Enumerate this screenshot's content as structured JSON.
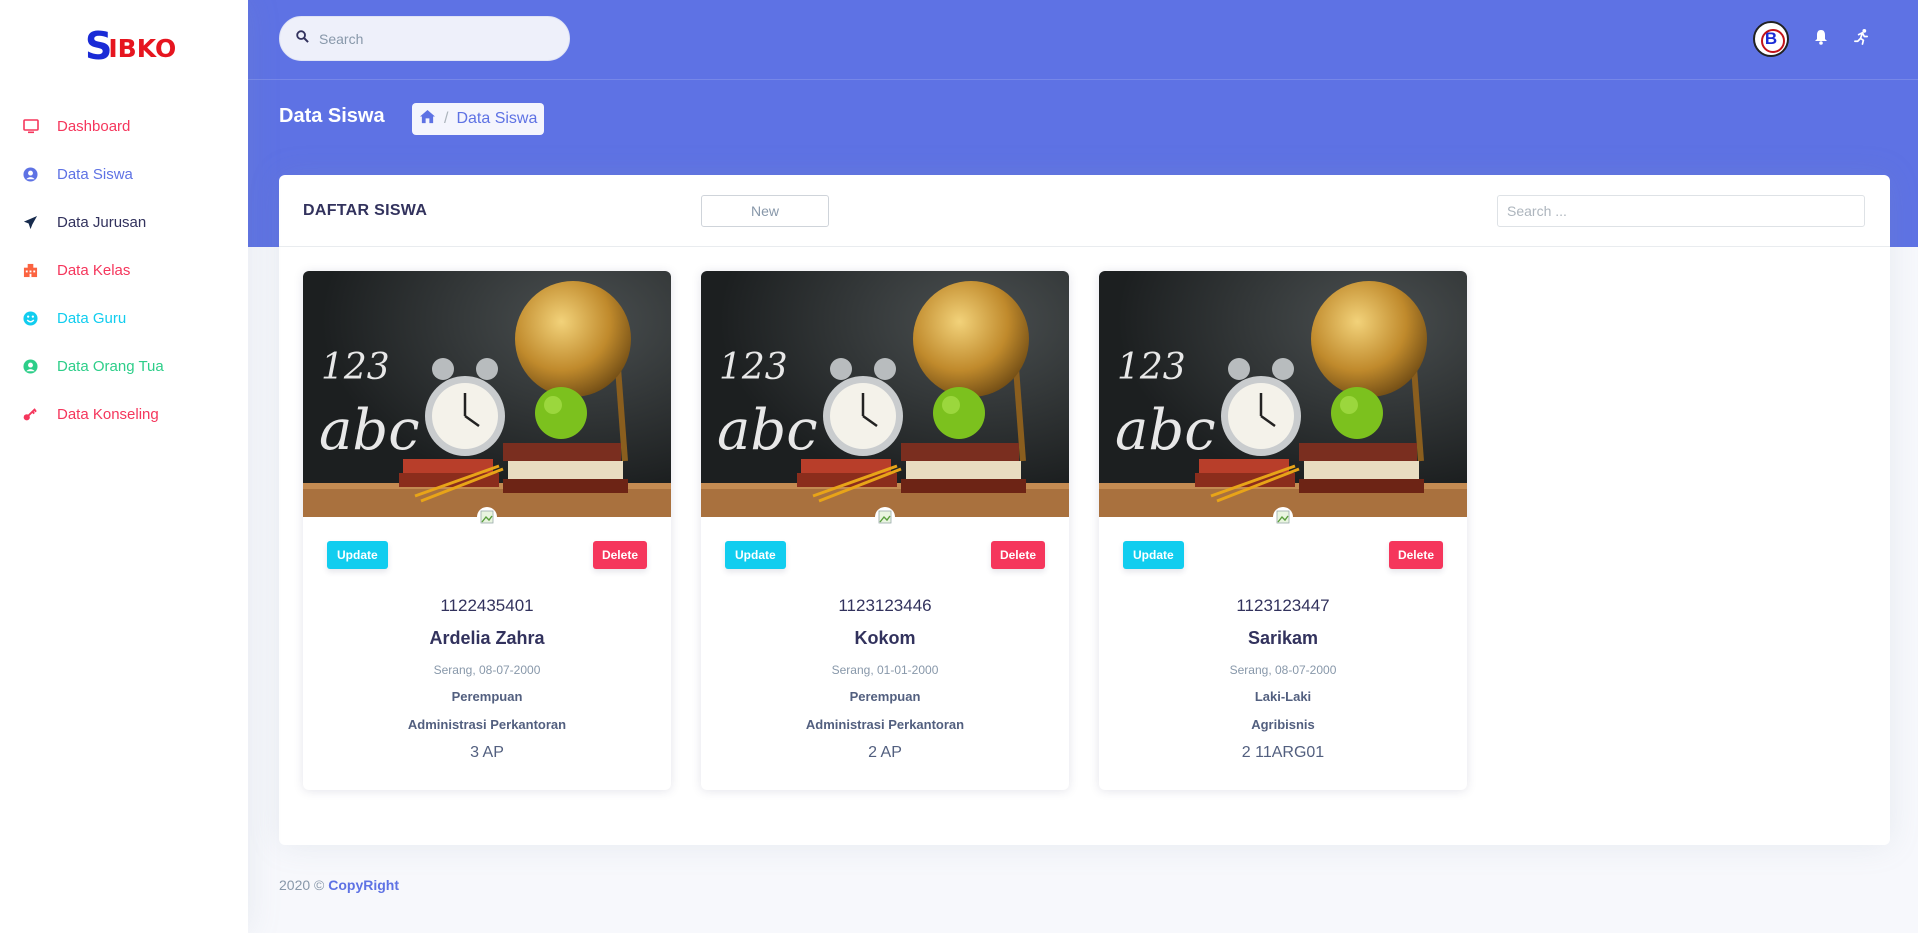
{
  "logo": {
    "first": "S",
    "rest": "IBKO"
  },
  "sidebar": {
    "items": [
      {
        "label": "Dashboard",
        "icon": "monitor-icon",
        "color": "#f5365c"
      },
      {
        "label": "Data Siswa",
        "icon": "user-circle-icon",
        "color": "#5e72e4"
      },
      {
        "label": "Data Jurusan",
        "icon": "send-icon",
        "color": "#32325d"
      },
      {
        "label": "Data Kelas",
        "icon": "building-icon",
        "color": "#f5365c"
      },
      {
        "label": "Data Guru",
        "icon": "smile-icon",
        "color": "#11cdef"
      },
      {
        "label": "Data Orang Tua",
        "icon": "user-circle-icon",
        "color": "#2dce89"
      },
      {
        "label": "Data Konseling",
        "icon": "key-icon",
        "color": "#f5365c"
      }
    ]
  },
  "topbar": {
    "search_placeholder": "Search",
    "avatar_text": "B",
    "icons": [
      "bell-icon",
      "running-icon"
    ]
  },
  "header": {
    "title": "Data Siswa",
    "breadcrumb": {
      "home_icon": "home-icon",
      "separator": "/",
      "current": "Data Siswa"
    }
  },
  "card": {
    "title": "DAFTAR SISWA",
    "new_label": "New",
    "search_placeholder": "Search ..."
  },
  "students": [
    {
      "nis": "1122435401",
      "name": "Ardelia Zahra",
      "ttl": "Serang, 08-07-2000",
      "gender": "Perempuan",
      "jurusan": "Administrasi Perkantoran",
      "kelas": "3 AP",
      "update": "Update",
      "delete": "Delete"
    },
    {
      "nis": "1123123446",
      "name": "Kokom",
      "ttl": "Serang, 01-01-2000",
      "gender": "Perempuan",
      "jurusan": "Administrasi Perkantoran",
      "kelas": "2 AP",
      "update": "Update",
      "delete": "Delete"
    },
    {
      "nis": "1123123447",
      "name": "Sarikam",
      "ttl": "Serang, 08-07-2000",
      "gender": "Laki-Laki",
      "jurusan": "Agribisnis",
      "kelas": "2 11ARG01",
      "update": "Update",
      "delete": "Delete"
    }
  ],
  "footer": {
    "text": "2020 ©",
    "link": "CopyRight"
  },
  "colors": {
    "primary": "#5e72e4",
    "info": "#11cdef",
    "danger": "#f5365c"
  }
}
